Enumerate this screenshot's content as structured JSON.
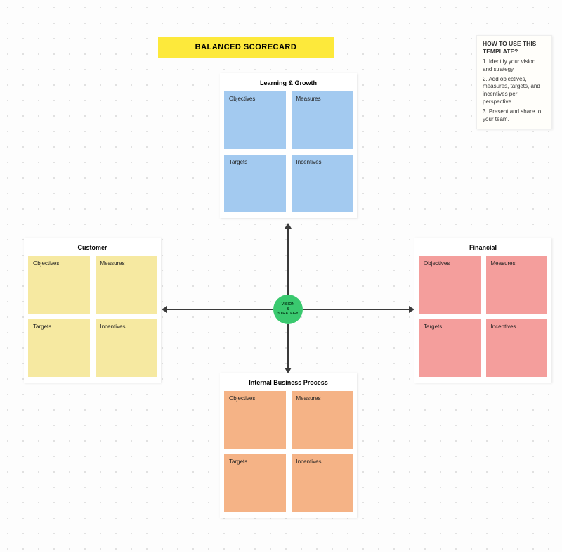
{
  "title": "BALANCED SCORECARD",
  "hub": {
    "line1": "VISION",
    "line2": "&",
    "line3": "STRATEGY"
  },
  "help": {
    "title": "HOW TO USE THIS TEMPLATE?",
    "steps": [
      "1. Identify your vision and strategy.",
      "2. Add objectives, measures, targets, and incentives per perspective.",
      "3. Present and share to your team."
    ]
  },
  "tileLabels": {
    "objectives": "Objectives",
    "measures": "Measures",
    "targets": "Targets",
    "incentives": "Incentives"
  },
  "perspectives": {
    "top": {
      "title": "Learning & Growth"
    },
    "left": {
      "title": "Customer"
    },
    "right": {
      "title": "Financial"
    },
    "bottom": {
      "title": "Internal Business Process"
    }
  }
}
